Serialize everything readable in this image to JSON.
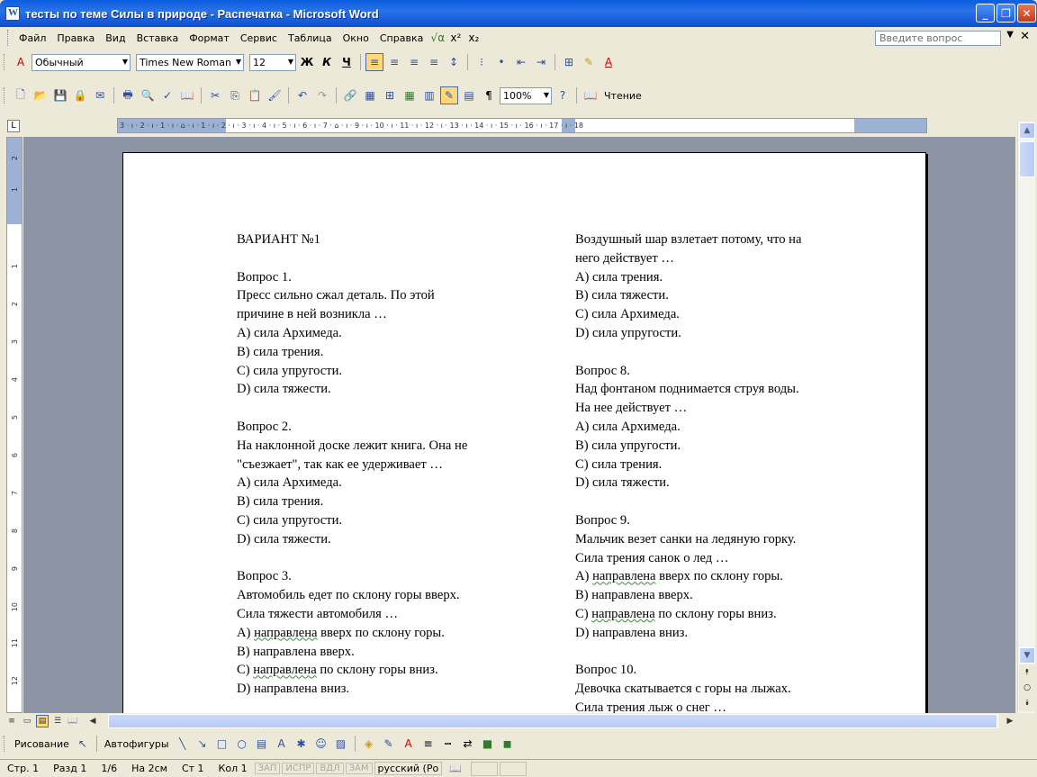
{
  "window": {
    "title": "тесты по теме Силы в природе - Распечатка - Microsoft Word"
  },
  "menu": {
    "items": [
      "Файл",
      "Правка",
      "Вид",
      "Вставка",
      "Формат",
      "Сервис",
      "Таблица",
      "Окно",
      "Справка"
    ],
    "help_placeholder": "Введите вопрос"
  },
  "formatting": {
    "style": "Обычный",
    "font": "Times New Roman",
    "size": "12"
  },
  "standard": {
    "zoom": "100%",
    "reading_label": "Чтение"
  },
  "ruler": {
    "text": "3 · ı · 2 · ı · 1 · ı · ⌂ · ı · 1 · ı · 2 · ı · 3 · ı · 4 · ı · 5 · ı · 6 · ı · 7 · ⌂ · ı · 9 · ı · 10 · ı · 11 · ı · 12 · ı · 13 · ı · 14 · ı · 15 · ı · 16 · ı · 17 · ı · 18"
  },
  "vruler": {
    "numbers": [
      "2",
      "1",
      "1",
      "2",
      "3",
      "4",
      "5",
      "6",
      "7",
      "8",
      "9",
      "10",
      "11",
      "12"
    ]
  },
  "document": {
    "left_column": [
      "ВАРИАНТ №1",
      "",
      "Вопрос 1.",
      "Пресс сильно сжал деталь. По этой",
      "причине в ней возникла …",
      "А) сила Архимеда.",
      "В) сила трения.",
      "С) сила упругости.",
      "D) сила тяжести.",
      "",
      "Вопрос 2.",
      "На наклонной доске лежит книга. Она не",
      "\"съезжает\", так как ее удерживает …",
      "А) сила Архимеда.",
      "В) сила трения.",
      "С) сила упругости.",
      "D) сила тяжести.",
      "",
      "Вопрос 3.",
      "Автомобиль едет по склону горы вверх.",
      "Сила тяжести автомобиля …",
      "А) направлена вверх по склону горы.",
      "В) направлена вверх.",
      "С) направлена по склону горы вниз.",
      "D) направлена вниз."
    ],
    "right_column": [
      "Воздушный шар взлетает потому, что на",
      "него действует …",
      "А) сила трения.",
      "В) сила тяжести.",
      "С) сила Архимеда.",
      "D) сила упругости.",
      "",
      "Вопрос 8.",
      "Над фонтаном поднимается струя воды.",
      "На нее действует …",
      "А) сила Архимеда.",
      "В) сила упругости.",
      "С) сила трения.",
      "D) сила тяжести.",
      "",
      "Вопрос 9.",
      "Мальчик везет санки на ледяную горку.",
      "Сила трения санок о лед …",
      "А) направлена вверх по склону горы.",
      "В) направлена вверх.",
      "С) направлена по склону горы вниз.",
      "D) направлена вниз.",
      "",
      "Вопрос 10.",
      "Девочка скатывается с горы на лыжах.",
      "Сила трения лыж о снег …"
    ]
  },
  "drawing": {
    "draw_label": "Рисование",
    "autoshapes_label": "Автофигуры"
  },
  "status": {
    "page": "Стр. 1",
    "section": "Разд 1",
    "pages": "1/6",
    "at": "На 2см",
    "line": "Ст 1",
    "col": "Кол 1",
    "rec": "ЗАП",
    "trk": "ИСПР",
    "ext": "ВДЛ",
    "ovr": "ЗАМ",
    "language": "русский (Ро"
  }
}
